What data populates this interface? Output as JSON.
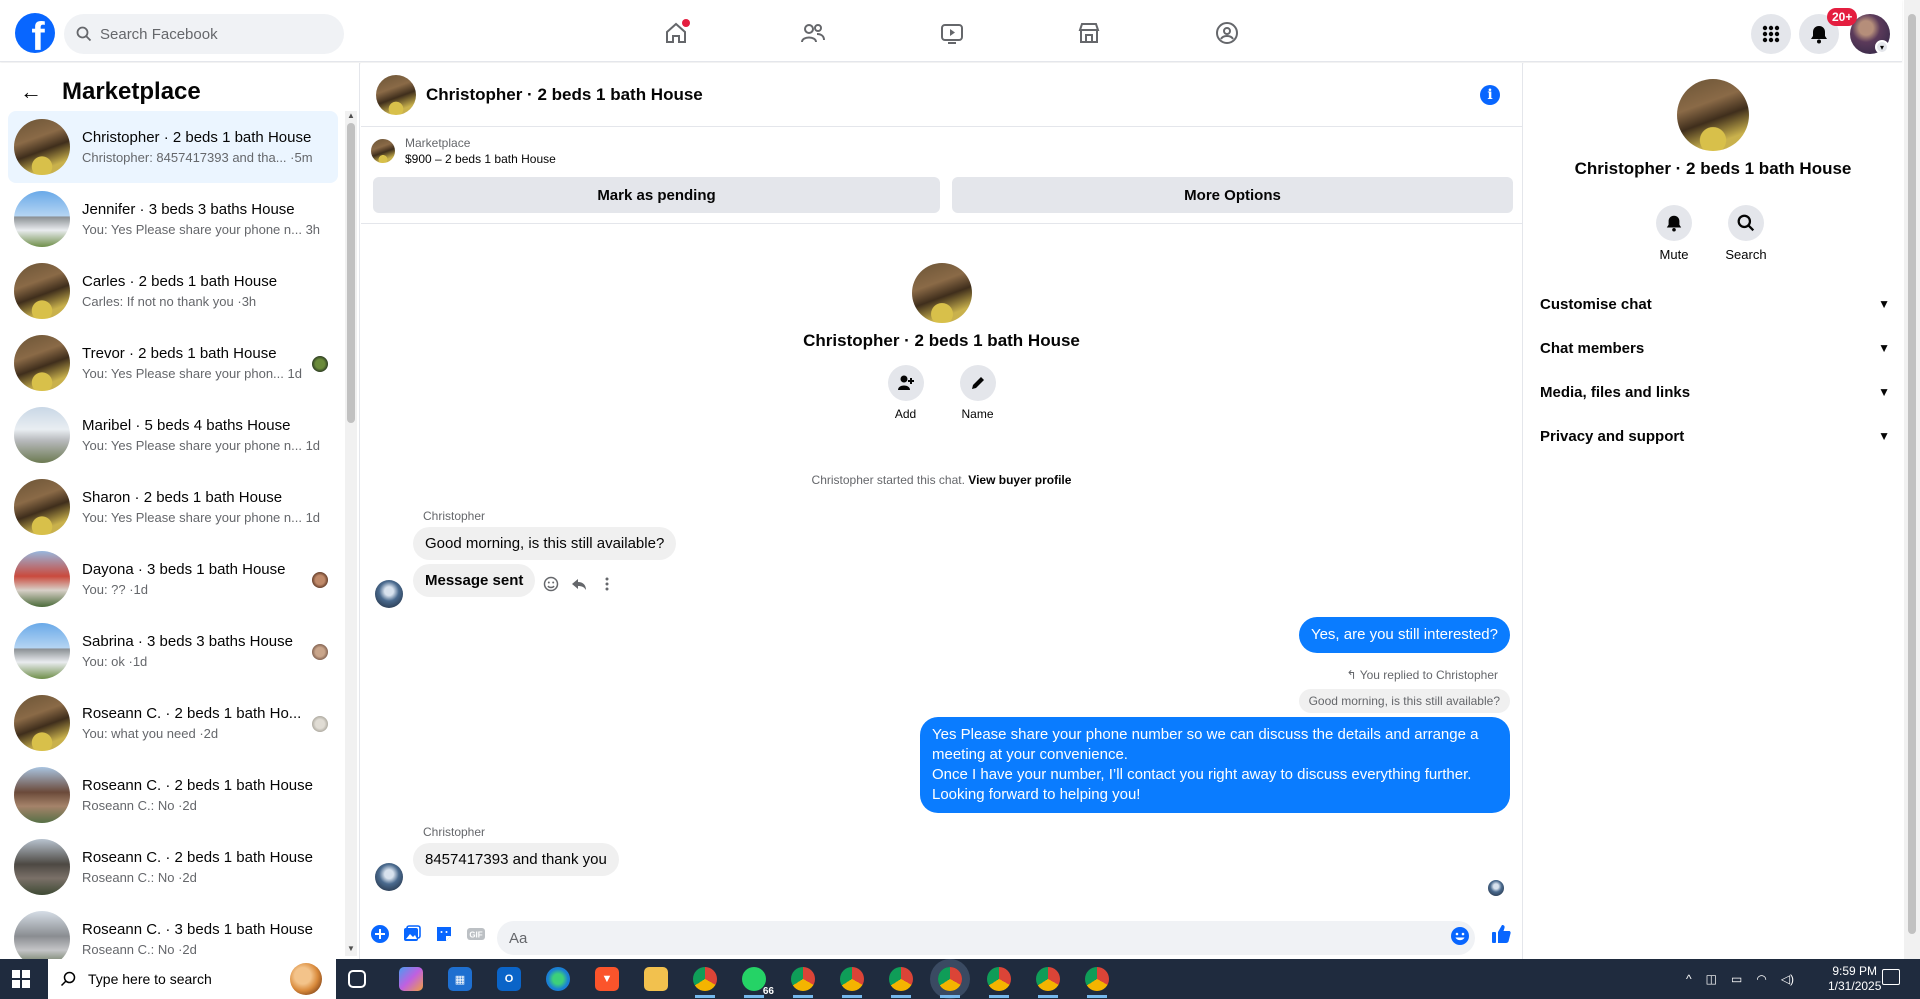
{
  "topbar": {
    "search_placeholder": "Search Facebook",
    "notifications_badge": "20+",
    "nav_icons": [
      "home-icon",
      "friends-icon",
      "video-icon",
      "marketplace-icon",
      "groups-icon"
    ],
    "brand_color": "#0866ff"
  },
  "sidebar": {
    "title": "Marketplace",
    "conversations": [
      {
        "title": "Christopher · 2 beds 1 bath House",
        "subtitle": "Christopher: 8457417393 and tha... ·5m"
      },
      {
        "title": "Jennifer · 3 beds 3 baths House",
        "subtitle": "You: Yes Please share your phone n... 3h"
      },
      {
        "title": "Carles · 2 beds 1 bath House",
        "subtitle": "Carles: If not no thank you ·3h"
      },
      {
        "title": "Trevor · 2 beds 1 bath House",
        "subtitle": "You: Yes Please share your phon... 1d"
      },
      {
        "title": "Maribel · 5 beds 4 baths House",
        "subtitle": "You: Yes Please share your phone n... 1d"
      },
      {
        "title": "Sharon · 2 beds 1 bath House",
        "subtitle": "You: Yes Please share your phone n... 1d"
      },
      {
        "title": "Dayona · 3 beds 1 bath House",
        "subtitle": "You: ?? ·1d"
      },
      {
        "title": "Sabrina · 3 beds 3 baths House",
        "subtitle": "You: ok ·1d"
      },
      {
        "title": "Roseann C. · 2 beds 1 bath Ho...",
        "subtitle": "You: what you need ·2d"
      },
      {
        "title": "Roseann C. · 2 beds 1 bath House",
        "subtitle": "Roseann C.: No ·2d"
      },
      {
        "title": "Roseann C. · 2 beds 1 bath House",
        "subtitle": "Roseann C.: No ·2d"
      },
      {
        "title": "Roseann C. · 3 beds 1 bath House",
        "subtitle": "Roseann C.: No ·2d"
      }
    ]
  },
  "chat": {
    "header_title": "Christopher · 2 beds 1 bath House",
    "banner_label": "Marketplace",
    "banner_price": "$900 – 2 beds 1 bath House",
    "mark_pending": "Mark as pending",
    "more_options": "More Options",
    "profile_name": "Christopher · 2 beds 1 bath House",
    "add_label": "Add",
    "name_label": "Name",
    "system_text": "Christopher started this chat.",
    "system_link": "View buyer profile",
    "sender1": "Christopher",
    "msg1": "Good morning, is this still available?",
    "msg2": "Message sent",
    "out1": "Yes, are you still interested?",
    "replied_to": "You replied to Christopher",
    "quoted": "Good morning, is this still available?",
    "out2_l1": "Yes Please share your phone number so we can discuss the details and arrange a",
    "out2_l2": "meeting at your convenience.",
    "out2_l3": "Once I have your number, I’ll contact you right away to discuss everything further.",
    "out2_l4": "Looking forward to helping you!",
    "sender2": "Christopher",
    "msg3": "8457417393 and thank you",
    "composer_placeholder": "Aa"
  },
  "details": {
    "name": "Christopher · 2 beds 1 bath House",
    "mute": "Mute",
    "search": "Search",
    "sections": [
      "Customise chat",
      "Chat members",
      "Media, files and links",
      "Privacy and support"
    ]
  },
  "taskbar": {
    "search_placeholder": "Type here to search",
    "whatsapp_count": "66",
    "time": "9:59 PM",
    "date": "1/31/2025"
  }
}
